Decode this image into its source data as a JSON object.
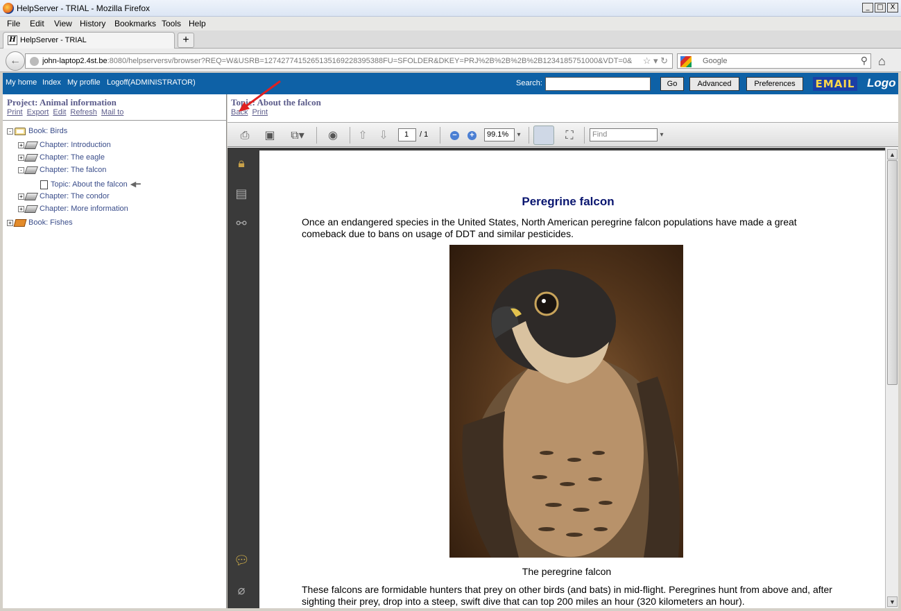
{
  "window": {
    "title": "HelpServer - TRIAL - Mozilla Firefox",
    "controls": [
      "_",
      "□",
      "X"
    ]
  },
  "menu": [
    "File",
    "Edit",
    "View",
    "History",
    "Bookmarks",
    "Tools",
    "Help"
  ],
  "tab": {
    "label": "HelpServer - TRIAL",
    "new_tab": "+"
  },
  "address": {
    "host": "john-laptop2.4st.be",
    "rest": ":8080/helpserversv/browser?REQ=W&USRB=1274277415265135169228395388FU=SFOLDER&DKEY=PRJ%2B%2B%2B%2B1234185751000&VDT=0&"
  },
  "search": {
    "engine": "Google"
  },
  "app_header": {
    "nav": [
      "My home",
      "Index",
      "My profile",
      "Logoff(ADMINISTRATOR)"
    ],
    "search_label": "Search:",
    "go": "Go",
    "advanced": "Advanced",
    "preferences": "Preferences",
    "email_logo": "EMAIL",
    "logo": "Logo"
  },
  "left": {
    "title": "Project: Animal information",
    "links": [
      "Print",
      "Export",
      "Edit",
      "Refresh",
      "Mail to"
    ],
    "tree": [
      {
        "label": "Book: Birds",
        "toggle": "-"
      },
      {
        "label": "Chapter: Introduction",
        "toggle": "+"
      },
      {
        "label": "Chapter: The eagle",
        "toggle": "+"
      },
      {
        "label": "Chapter: The falcon",
        "toggle": "-"
      },
      {
        "label": "Topic: About the falcon",
        "toggle": ""
      },
      {
        "label": "Chapter: The condor",
        "toggle": "+"
      },
      {
        "label": "Chapter: More information",
        "toggle": "+"
      },
      {
        "label": "Book: Fishes",
        "toggle": "+"
      }
    ]
  },
  "right": {
    "title": "Topic: About the falcon",
    "links": [
      "Back",
      "Print"
    ]
  },
  "pdf": {
    "page": "1",
    "total": "/ 1",
    "zoom": "99.1%",
    "find_placeholder": "Find"
  },
  "doc": {
    "heading": "Peregrine falcon",
    "para1": "Once an endangered species in the United States, North American peregrine falcon populations have made a great comeback due to bans on usage of DDT and similar pesticides.",
    "caption": "The peregrine falcon",
    "para2": "These falcons are formidable hunters that prey on other birds (and bats) in mid-flight. Peregrines hunt from above and, after sighting their prey, drop into a steep, swift dive that can top 200 miles an hour (320 kilometers an hour)."
  }
}
